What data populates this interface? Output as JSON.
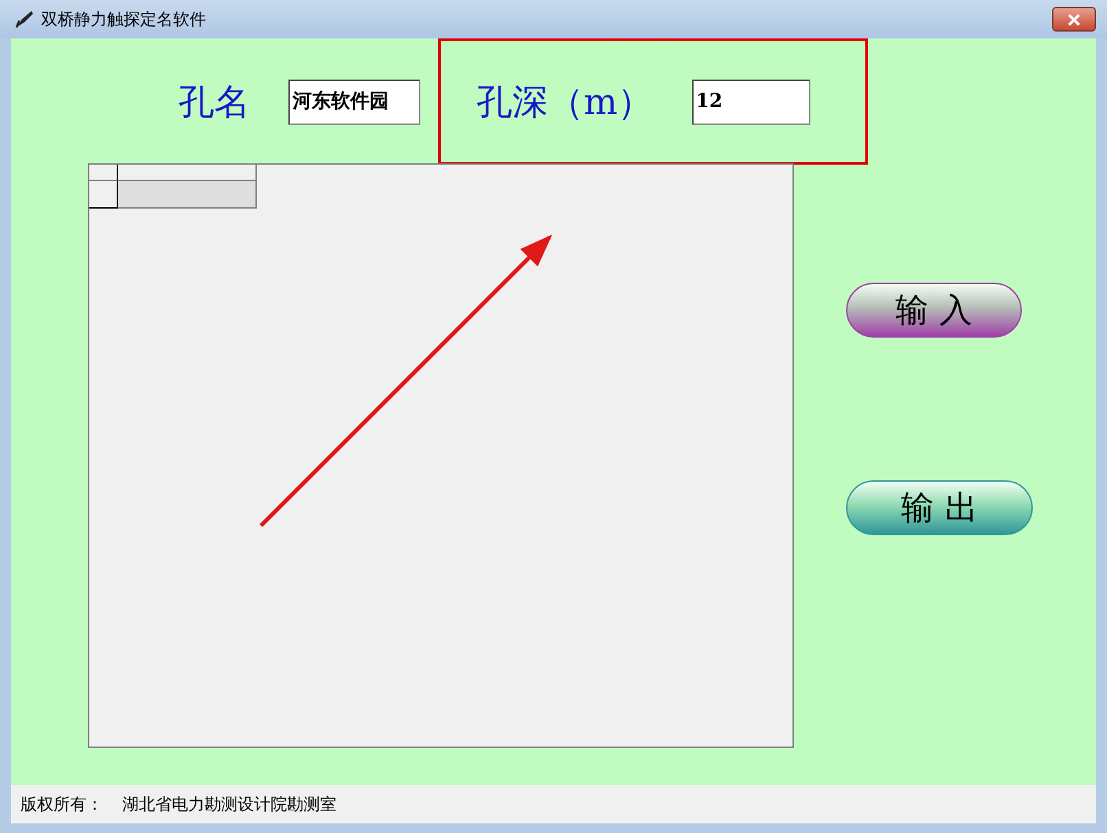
{
  "window": {
    "title": "双桥静力触探定名软件"
  },
  "fields": [
    {
      "label": "孔名",
      "value": "河东软件园",
      "highlighted": false
    },
    {
      "label": "孔深（m）",
      "value": "12",
      "highlighted": true
    }
  ],
  "buttons": [
    {
      "label": "输 入",
      "color": "#a040a8"
    },
    {
      "label": "输 出",
      "color": "#309898"
    }
  ],
  "annotations": [
    {
      "kind": "arrow"
    }
  ],
  "status_bar": {
    "label": "版权所有：",
    "value": "湖北省电力勘测设计院勘测室"
  }
}
